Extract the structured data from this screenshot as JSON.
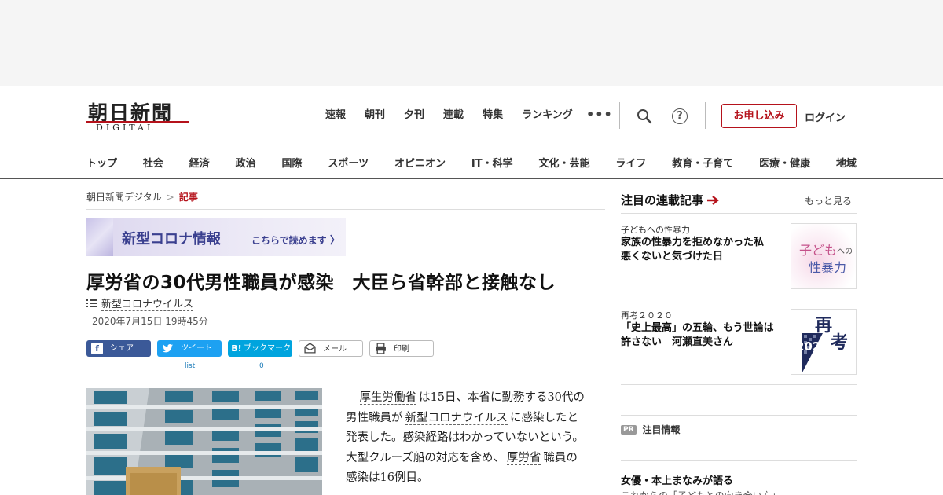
{
  "logo": {
    "main": "朝日新聞",
    "sub": "DIGITAL"
  },
  "topnav": [
    "速報",
    "朝刊",
    "夕刊",
    "連載",
    "特集",
    "ランキング"
  ],
  "more_label": "•••",
  "help_label": "?",
  "apply_label": "お申し込み",
  "login_label": "ログイン",
  "catnav": [
    "トップ",
    "社会",
    "経済",
    "政治",
    "国際",
    "スポーツ",
    "オピニオン",
    "IT・科学",
    "文化・芸能",
    "ライフ",
    "教育・子育て",
    "医療・健康",
    "地域"
  ],
  "breadcrumb": {
    "home": "朝日新聞デジタル",
    "sep": ">",
    "current": "記事"
  },
  "banner": {
    "main": "新型コロナ情報",
    "sub": "こちらで読めます"
  },
  "article": {
    "headline": "厚労省の30代男性職員が感染　大臣ら省幹部と接触なし",
    "tag": "新型コロナウイルス",
    "date": "2020年7月15日 19時45分",
    "body": {
      "link1": "厚生労働省",
      "t1": "は15日、本省に勤務する30代の男性職員が",
      "link2": "新型コロナウイルス",
      "t2": "に感染したと発表した。感染経路はわかっていないという。大型クルーズ船の対応を含め、",
      "link3": "厚労省",
      "t3": "職員の感染は16例目。"
    }
  },
  "share": {
    "facebook": "シェア",
    "twitter": "ツイート",
    "twitter_count": "list",
    "hatena_icon": "B!",
    "hatena": "ブックマーク",
    "hatena_count": "0",
    "mail": "メール",
    "print": "印刷"
  },
  "sidebar": {
    "title": "注目の連載記事",
    "more": "もっと見る",
    "items": [
      {
        "category": "子どもへの性暴力",
        "headline": "家族の性暴力を拒めなかった私　悪くないと気づけた日",
        "thumb_text_1": "子ども",
        "thumb_text_2": "への",
        "thumb_text_3": "性暴力"
      },
      {
        "category": "再考２０２０",
        "headline": "「史上最高」の五輪、もう世論は許さない　河瀬直美さん",
        "thumb_text_1": "再",
        "thumb_text_2": "考",
        "thumb_text_3": "2020"
      }
    ],
    "pr_badge": "PR",
    "pr_label": "注目情報",
    "bottom_title": "女優・本上まなみが語る",
    "bottom_sub": "これからの「子どもとの向き合い方」"
  },
  "colors": {
    "brand_red": "#b5121b",
    "facebook": "#3b5998",
    "twitter": "#1da1f2",
    "hatena": "#00a4de",
    "banner_text": "#3a3f8f"
  }
}
